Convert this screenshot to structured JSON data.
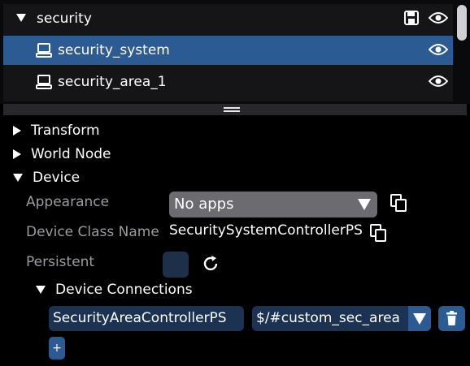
{
  "tree": {
    "group_label": "security",
    "items": [
      {
        "label": "security_system",
        "selected": true
      },
      {
        "label": "security_area_1",
        "selected": false
      }
    ]
  },
  "properties": {
    "sections": {
      "transform": "Transform",
      "world_node": "World Node",
      "device": "Device"
    },
    "appearance": {
      "label": "Appearance",
      "value": "No apps"
    },
    "device_class": {
      "label": "Device Class Name",
      "value": "SecuritySystemControllerPS"
    },
    "persistent": {
      "label": "Persistent"
    },
    "device_connections": {
      "label": "Device Connections",
      "connection_class": "SecurityAreaControllerPS",
      "connection_path": "$/#custom_sec_area",
      "add_label": "+"
    }
  },
  "colors": {
    "selected": "#2c5a92",
    "field_bg": "#1c3253",
    "combo_bg": "#6b6b70"
  }
}
